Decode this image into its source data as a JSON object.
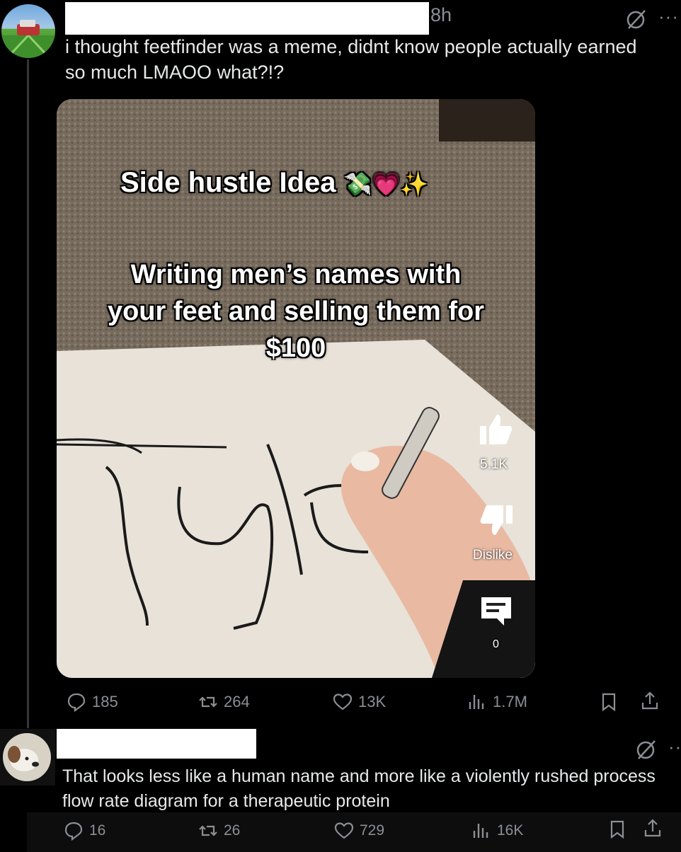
{
  "post": {
    "time": "8h",
    "text": "i thought feetfinder was a meme, didnt know people actually earned so much LMAOO what?!?",
    "more_label": "···",
    "media": {
      "overlay_title": "Side hustle Idea",
      "overlay_emoji": "💸💗✨",
      "overlay_body_line1": "Writing men’s names with",
      "overlay_body_line2": "your feet and selling them for",
      "overlay_body_line3": "$100",
      "like_count": "5.1K",
      "dislike_label": "Dislike",
      "comment_count": "0"
    },
    "stats": {
      "replies": "185",
      "reposts": "264",
      "likes": "13K",
      "views": "1.7M"
    }
  },
  "reply": {
    "text_line1": "That looks less like a human name and more like a violently rushed process",
    "text_line2": "flow rate diagram for a therapeutic protein",
    "more_label": "··",
    "stats": {
      "replies": "16",
      "reposts": "26",
      "likes": "729",
      "views": "16K"
    }
  },
  "icons": {
    "reply": "reply-icon",
    "repost": "repost-icon",
    "like": "heart-icon",
    "views": "views-icon",
    "bookmark": "bookmark-icon",
    "share": "share-icon",
    "grok": "grok-icon"
  },
  "colors": {
    "background": "#000000",
    "muted": "#8b8f94",
    "text": "#e7e9ea"
  }
}
